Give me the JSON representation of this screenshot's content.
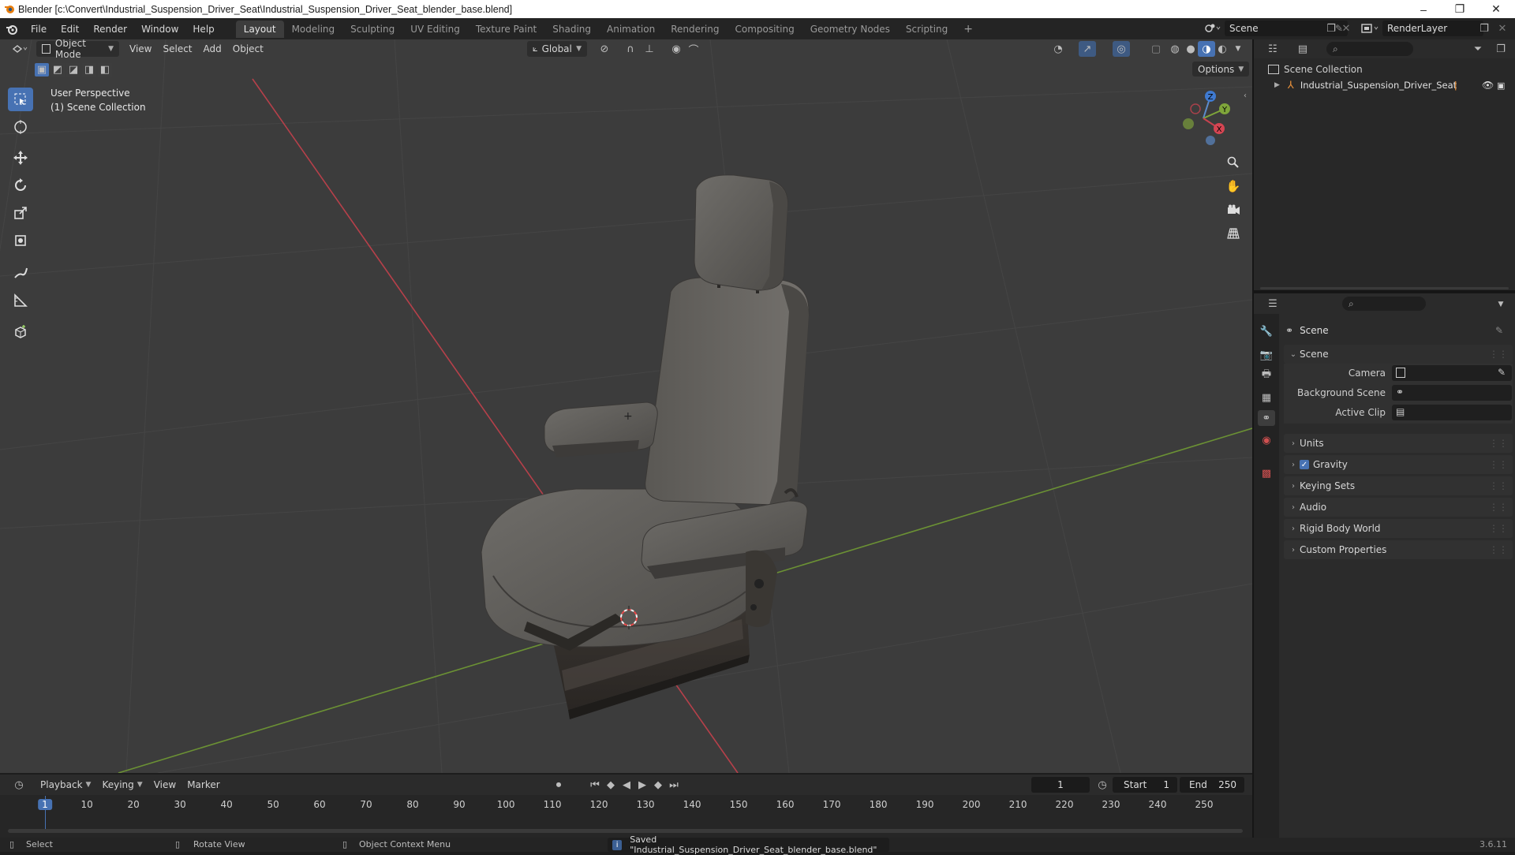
{
  "window": {
    "title": "Blender [c:\\Convert\\Industrial_Suspension_Driver_Seat\\Industrial_Suspension_Driver_Seat_blender_base.blend]",
    "minimize": "–",
    "maximize": "❐",
    "close": "✕"
  },
  "menu": [
    "File",
    "Edit",
    "Render",
    "Window",
    "Help"
  ],
  "workspaces": [
    "Layout",
    "Modeling",
    "Sculpting",
    "UV Editing",
    "Texture Paint",
    "Shading",
    "Animation",
    "Rendering",
    "Compositing",
    "Geometry Nodes",
    "Scripting",
    "+"
  ],
  "active_workspace": "Layout",
  "scene_selector": {
    "value": "Scene"
  },
  "view_layer_selector": {
    "value": "RenderLayer"
  },
  "viewport": {
    "mode": "Object Mode",
    "menus": [
      "View",
      "Select",
      "Add",
      "Object"
    ],
    "transform_orientation": "Global",
    "options": "Options",
    "info_line1": "User Perspective",
    "info_line2": "(1) Scene Collection",
    "gizmo": {
      "z": "Z",
      "y": "Y",
      "x": "X"
    }
  },
  "outliner": {
    "root": "Scene Collection",
    "items": [
      {
        "label": "Industrial_Suspension_Driver_Seat"
      }
    ]
  },
  "properties": {
    "header": "Scene",
    "section": "Scene",
    "fields": [
      {
        "label": "Camera"
      },
      {
        "label": "Background Scene"
      },
      {
        "label": "Active Clip"
      }
    ],
    "panels": [
      "Units",
      "Gravity",
      "Keying Sets",
      "Audio",
      "Rigid Body World",
      "Custom Properties"
    ],
    "gravity_checked": true
  },
  "timeline": {
    "menus": [
      "Playback",
      "Keying",
      "View",
      "Marker"
    ],
    "current_frame": "1",
    "start_label": "Start",
    "start": "1",
    "end_label": "End",
    "end": "250",
    "frames": [
      "1",
      "10",
      "20",
      "30",
      "40",
      "50",
      "60",
      "70",
      "80",
      "90",
      "100",
      "110",
      "120",
      "130",
      "140",
      "150",
      "160",
      "170",
      "180",
      "190",
      "200",
      "210",
      "220",
      "230",
      "240",
      "250"
    ]
  },
  "statusbar": {
    "select": "Select",
    "rotate": "Rotate View",
    "context": "Object Context Menu",
    "message": "Saved \"Industrial_Suspension_Driver_Seat_blender_base.blend\"",
    "version": "3.6.11"
  },
  "colors": {
    "accent": "#4772b3",
    "x_axis": "#c8424f",
    "y_axis": "#7fa53a",
    "viewport_bg": "#3c3c3c"
  }
}
